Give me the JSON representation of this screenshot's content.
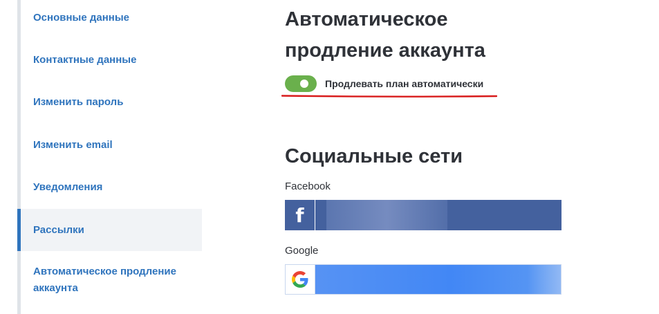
{
  "sidebar": {
    "items": [
      {
        "label": "Основные данные",
        "active": false
      },
      {
        "label": "Контактные данные",
        "active": false
      },
      {
        "label": "Изменить пароль",
        "active": false
      },
      {
        "label": "Изменить email",
        "active": false
      },
      {
        "label": "Уведомления",
        "active": false
      },
      {
        "label": "Рассылки",
        "active": true
      },
      {
        "label": "Автоматическое продление аккаунта",
        "active": false
      }
    ]
  },
  "auto_renewal": {
    "title": "Автоматическое продление аккаунта",
    "toggle_label": "Продлевать план автоматически",
    "toggle_on": true
  },
  "social": {
    "title": "Социальные сети",
    "facebook": {
      "label": "Facebook",
      "icon": "facebook-icon",
      "color": "#44619e"
    },
    "google": {
      "label": "Google",
      "icon": "google-icon",
      "color": "#4287f5"
    }
  },
  "colors": {
    "link": "#2f74bd",
    "toggle_on": "#6ab04c",
    "annotation_underline": "#d81b1b"
  }
}
